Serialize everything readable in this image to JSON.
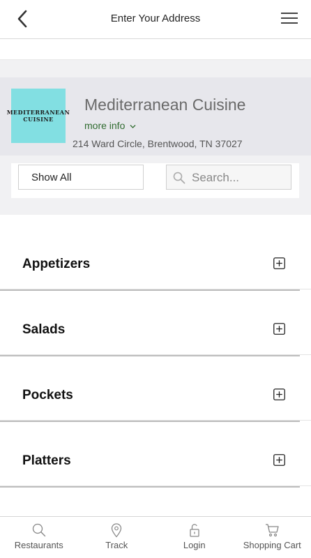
{
  "header": {
    "title": "Enter Your Address",
    "back_icon": "chevron-left-icon",
    "menu_icon": "hamburger-menu-icon"
  },
  "restaurant": {
    "logo_text_line1": "MEDITERRANEAN",
    "logo_text_line2": "CUISINE",
    "logo_bg_color": "#82dfe2",
    "name": "Mediterranean Cuisine",
    "more_info_label": "more info",
    "address": "214 Ward Circle, Brentwood, TN 37027"
  },
  "filters": {
    "show_all_label": "Show All",
    "search_placeholder": "Search...",
    "search_value": ""
  },
  "categories": [
    {
      "label": "Appetizers"
    },
    {
      "label": "Salads"
    },
    {
      "label": "Pockets"
    },
    {
      "label": "Platters"
    }
  ],
  "bottom_nav": [
    {
      "label": "Restaurants",
      "icon": "search-icon"
    },
    {
      "label": "Track",
      "icon": "map-pin-icon"
    },
    {
      "label": "Login",
      "icon": "unlock-icon"
    },
    {
      "label": "Shopping Cart",
      "icon": "cart-icon"
    }
  ],
  "colors": {
    "header_band": "#e7e7ec",
    "filter_band": "#f1f1f3",
    "more_info": "#2f6b2f"
  }
}
